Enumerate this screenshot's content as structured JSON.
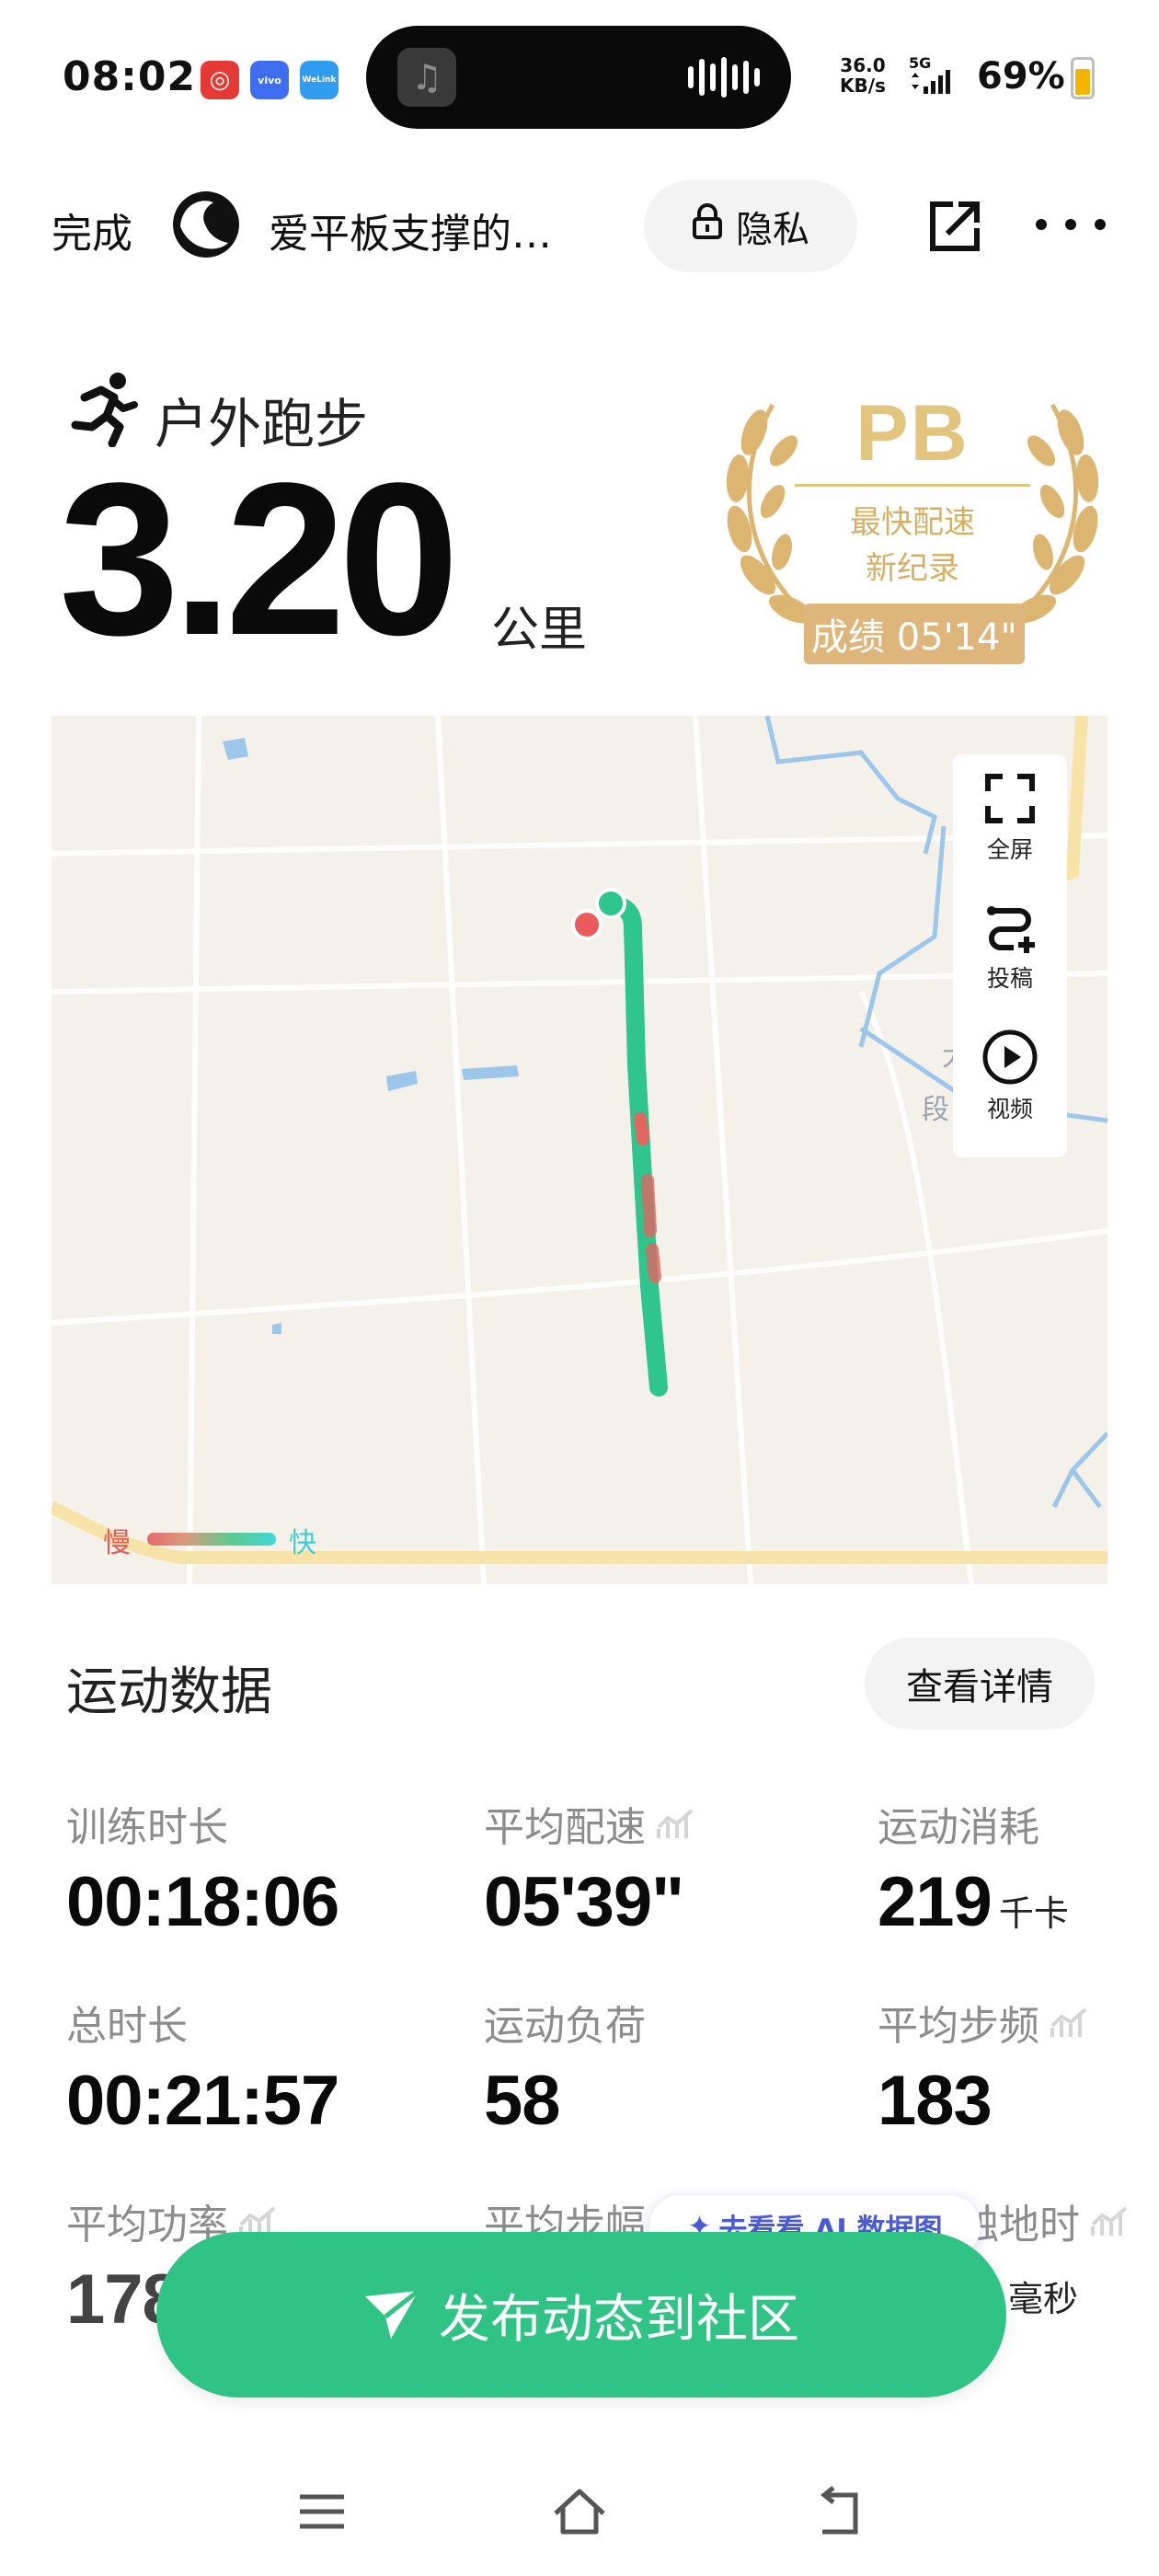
{
  "status_bar": {
    "time": "08:02",
    "app_icons": [
      {
        "name": "netease-music-icon",
        "color": "#e53935",
        "glyph": "◎"
      },
      {
        "name": "vivo-app-icon",
        "color": "#3f6df0",
        "glyph": "vivo"
      },
      {
        "name": "welink-icon",
        "color": "#2f9cf0",
        "glyph": "WeLink"
      }
    ],
    "network_speed": "36.0",
    "network_unit": "KB/s",
    "network_type": "5G",
    "battery": "69%",
    "battery_level": 0.69
  },
  "title_bar": {
    "done_label": "完成",
    "username": "爱平板支撑的…",
    "privacy_label": "隐私"
  },
  "workout": {
    "type": "户外跑步",
    "distance": "3.20",
    "unit": "公里"
  },
  "pb_badge": {
    "title": "PB",
    "line1": "最快配速",
    "line2": "新纪录",
    "score": "成绩 05'14\""
  },
  "map": {
    "tools": [
      {
        "key": "fullscreen",
        "label": "全屏",
        "icon": "fullscreen-icon"
      },
      {
        "key": "submit",
        "label": "投稿",
        "icon": "route-submit-icon"
      },
      {
        "key": "video",
        "label": "视频",
        "icon": "play-icon"
      }
    ],
    "legend_slow": "慢",
    "legend_fast": "快",
    "map_fragment_1": "大",
    "map_fragment_2": "段",
    "colors": {
      "route_fast": "#2ec58f",
      "route_slow": "#e0665f",
      "water": "#9cc6ea",
      "road": "#f7e3a8"
    }
  },
  "data_section": {
    "title": "运动数据",
    "detail_label": "查看详情",
    "metrics": [
      {
        "label": "训练时长",
        "value": "00:18:06",
        "unit": "",
        "chart_icon": false
      },
      {
        "label": "平均配速",
        "value": "05'39\"",
        "unit": "",
        "chart_icon": true
      },
      {
        "label": "运动消耗",
        "value": "219",
        "unit": "千卡",
        "chart_icon": false
      },
      {
        "label": "总时长",
        "value": "00:21:57",
        "unit": "",
        "chart_icon": false
      },
      {
        "label": "运动负荷",
        "value": "58",
        "unit": "",
        "chart_icon": false
      },
      {
        "label": "平均步频",
        "value": "183",
        "unit": "",
        "chart_icon": true
      },
      {
        "label": "平均功率",
        "value": "178",
        "unit": "",
        "chart_icon": true
      },
      {
        "label": "平均步幅",
        "value": "",
        "unit": "",
        "chart_icon": true
      },
      {
        "label": "平均触地时",
        "value": "",
        "unit": "毫秒",
        "chart_icon": true
      }
    ]
  },
  "ai_pill": {
    "label": "去看看 AI 数据图"
  },
  "publish": {
    "label": "发布动态到社区"
  }
}
